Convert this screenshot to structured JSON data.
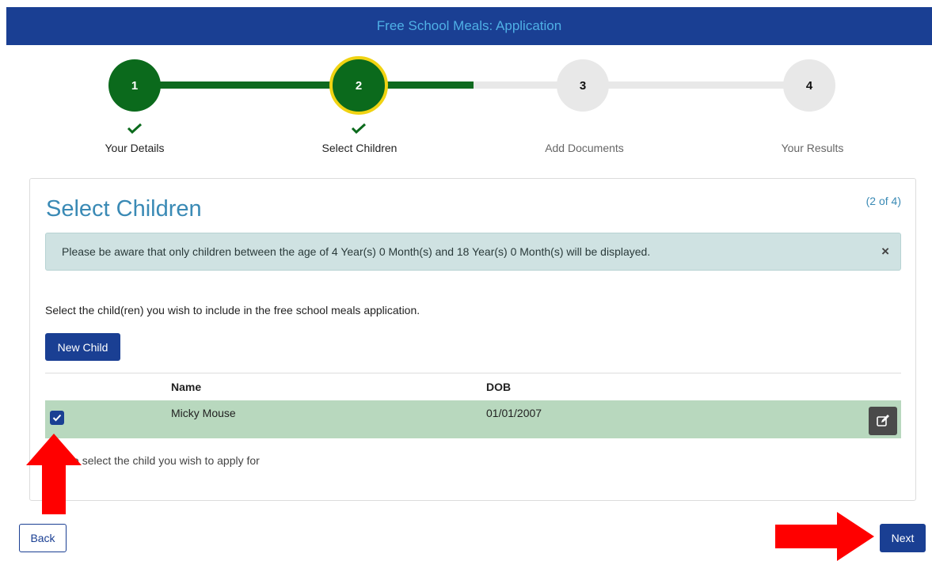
{
  "header": {
    "title": "Free School Meals: Application"
  },
  "stepper": {
    "steps": [
      {
        "number": "1",
        "label": "Your Details",
        "state": "done"
      },
      {
        "number": "2",
        "label": "Select Children",
        "state": "current"
      },
      {
        "number": "3",
        "label": "Add Documents",
        "state": "todo"
      },
      {
        "number": "4",
        "label": "Your Results",
        "state": "todo"
      }
    ],
    "colors": {
      "done": "#0b6a1c",
      "current_border": "#f0d312",
      "todo": "#e8e8e8"
    }
  },
  "panel": {
    "title": "Select Children",
    "step_indicator": "(2 of 4)",
    "alert": {
      "text": "Please be aware that only children between the age of 4 Year(s) 0 Month(s) and 18 Year(s) 0 Month(s) will be displayed.",
      "close": "×"
    },
    "instructions": "Select the child(ren) you wish to include in the free school meals application.",
    "new_child_label": "New Child",
    "table": {
      "headers": [
        "Name",
        "DOB"
      ],
      "rows": [
        {
          "name": "Micky Mouse",
          "dob": "01/01/2007",
          "selected": true
        }
      ]
    },
    "hint": "Please select the child you wish to apply for"
  },
  "footer": {
    "back_label": "Back",
    "next_label": "Next"
  },
  "colors": {
    "brand": "#1a3f93",
    "accent_text": "#3a8ab5",
    "annotation_arrow": "#ff0000"
  }
}
